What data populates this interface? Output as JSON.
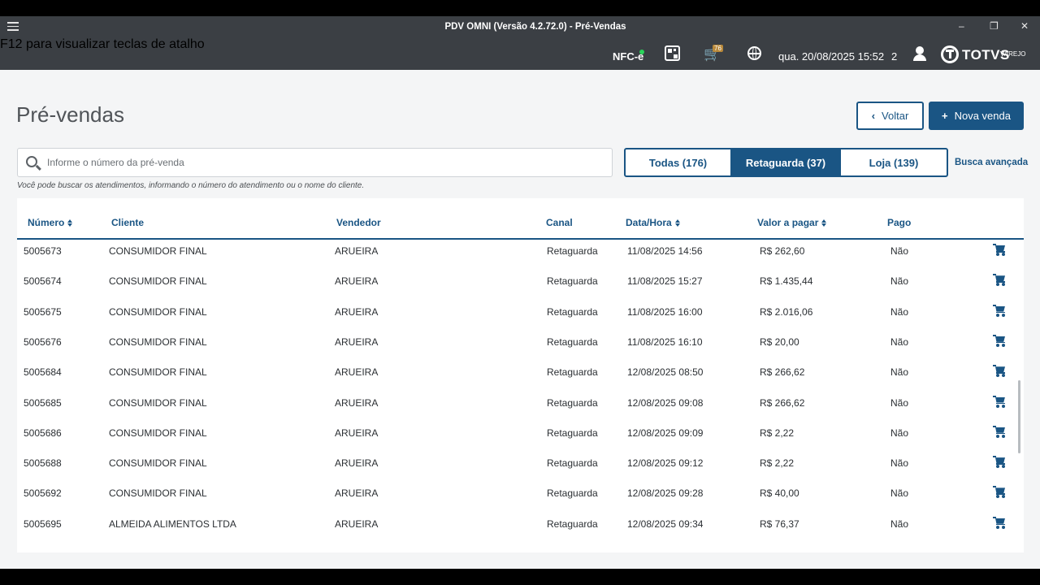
{
  "window": {
    "title": "PDV OMNI (Versão 4.2.72.0) - Pré-Vendas",
    "hint": "F12 para visualizar teclas de atalho",
    "minimize": "–",
    "restore": "❐",
    "close": "✕"
  },
  "topbar": {
    "nfce_label": "NFC-e",
    "cart_badge": "76",
    "datetime": "qua. 20/08/2025 15:52",
    "user_count": "2",
    "brand": "TOTVS",
    "brand_sub": "VAREJO"
  },
  "page": {
    "title": "Pré-vendas",
    "back_label": "Voltar",
    "new_sale_label": "Nova venda",
    "search_placeholder": "Informe o número da pré-venda",
    "search_help": "Você pode buscar os atendimentos, informando o número do atendimento ou o nome do cliente.",
    "advanced_search": "Busca avançada",
    "filters": [
      "Todas (176)",
      "Retaguarda (37)",
      "Loja (139)"
    ],
    "active_filter": "Retaguarda (37)"
  },
  "table": {
    "headers": {
      "numero": "Número",
      "cliente": "Cliente",
      "vendedor": "Vendedor",
      "canal": "Canal",
      "datahora": "Data/Hora",
      "valor": "Valor a pagar",
      "pago": "Pago"
    },
    "rows": [
      {
        "numero": "5005673",
        "cliente": "CONSUMIDOR FINAL",
        "vendedor": "ARUEIRA",
        "canal": "Retaguarda",
        "datahora": "11/08/2025 14:56",
        "valor": "R$ 262,60",
        "pago": "Não"
      },
      {
        "numero": "5005674",
        "cliente": "CONSUMIDOR FINAL",
        "vendedor": "ARUEIRA",
        "canal": "Retaguarda",
        "datahora": "11/08/2025 15:27",
        "valor": "R$ 1.435,44",
        "pago": "Não"
      },
      {
        "numero": "5005675",
        "cliente": "CONSUMIDOR FINAL",
        "vendedor": "ARUEIRA",
        "canal": "Retaguarda",
        "datahora": "11/08/2025 16:00",
        "valor": "R$ 2.016,06",
        "pago": "Não"
      },
      {
        "numero": "5005676",
        "cliente": "CONSUMIDOR FINAL",
        "vendedor": "ARUEIRA",
        "canal": "Retaguarda",
        "datahora": "11/08/2025 16:10",
        "valor": "R$ 20,00",
        "pago": "Não"
      },
      {
        "numero": "5005684",
        "cliente": "CONSUMIDOR FINAL",
        "vendedor": "ARUEIRA",
        "canal": "Retaguarda",
        "datahora": "12/08/2025 08:50",
        "valor": "R$ 266,62",
        "pago": "Não"
      },
      {
        "numero": "5005685",
        "cliente": "CONSUMIDOR FINAL",
        "vendedor": "ARUEIRA",
        "canal": "Retaguarda",
        "datahora": "12/08/2025 09:08",
        "valor": "R$ 266,62",
        "pago": "Não"
      },
      {
        "numero": "5005686",
        "cliente": "CONSUMIDOR FINAL",
        "vendedor": "ARUEIRA",
        "canal": "Retaguarda",
        "datahora": "12/08/2025 09:09",
        "valor": "R$ 2,22",
        "pago": "Não"
      },
      {
        "numero": "5005688",
        "cliente": "CONSUMIDOR FINAL",
        "vendedor": "ARUEIRA",
        "canal": "Retaguarda",
        "datahora": "12/08/2025 09:12",
        "valor": "R$ 2,22",
        "pago": "Não"
      },
      {
        "numero": "5005692",
        "cliente": "CONSUMIDOR FINAL",
        "vendedor": "ARUEIRA",
        "canal": "Retaguarda",
        "datahora": "12/08/2025 09:28",
        "valor": "R$ 40,00",
        "pago": "Não"
      },
      {
        "numero": "5005695",
        "cliente": "ALMEIDA ALIMENTOS LTDA",
        "vendedor": "ARUEIRA",
        "canal": "Retaguarda",
        "datahora": "12/08/2025 09:34",
        "valor": "R$ 76,37",
        "pago": "Não"
      }
    ]
  },
  "colors": {
    "primary": "#1a5584",
    "titlebar": "#3b3f44",
    "background": "#f4f5f6"
  }
}
